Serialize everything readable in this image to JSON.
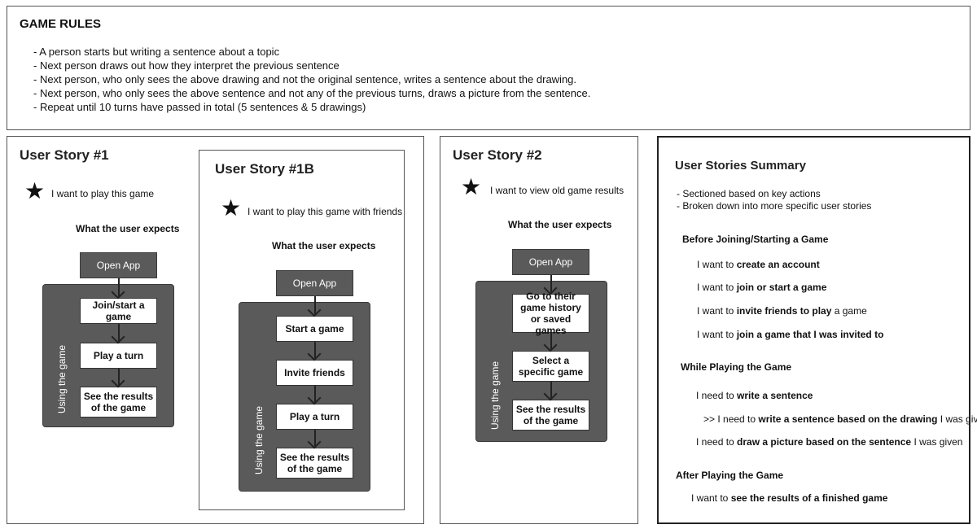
{
  "game_rules": {
    "title": "GAME RULES",
    "lines": [
      "- A person starts but writing a sentence about a topic",
      "- Next person draws out how they interpret the previous sentence",
      "- Next person, who only sees the above drawing and not the original sentence, writes a sentence about the drawing.",
      "- Next person, who only sees the above sentence and not any of the previous turns, draws a picture from the sentence.",
      "- Repeat until 10 turns have passed in total (5 sentences & 5 drawings)"
    ]
  },
  "story1": {
    "title": "User Story #1",
    "want": "I want to play this game",
    "expects": "What the user expects",
    "open_app": "Open App",
    "panel_label": "Using the game",
    "steps": [
      "Join/start a game",
      "Play a turn",
      "See the results of the game"
    ]
  },
  "story1b": {
    "title": "User Story #1B",
    "want": "I want to play this game with friends",
    "expects": "What the user expects",
    "open_app": "Open App",
    "panel_label": "Using the game",
    "steps": [
      "Start a game",
      "Invite friends",
      "Play a turn",
      "See the results of the game"
    ]
  },
  "story2": {
    "title": "User Story #2",
    "want": "I want to view old game results",
    "expects": "What the user expects",
    "open_app": "Open App",
    "panel_label": "Using the game",
    "steps": [
      "Go to their game history or saved games",
      "Select a specific game",
      "See the results of the game"
    ]
  },
  "summary": {
    "title": "User Stories Summary",
    "notes": [
      "- Sectioned based on key actions",
      "- Broken down into more specific user stories"
    ],
    "sections": [
      {
        "heading": "Before Joining/Starting a Game",
        "items": [
          {
            "pre": "I want to ",
            "bold": "create an account",
            "post": ""
          },
          {
            "pre": "I want to ",
            "bold": "join or start a game",
            "post": ""
          },
          {
            "pre": "I want to ",
            "bold": "invite friends to play",
            "post": " a game"
          },
          {
            "pre": "I want to ",
            "bold": "join a game that I was invited to",
            "post": ""
          }
        ]
      },
      {
        "heading": "While Playing the Game",
        "items": [
          {
            "pre": "I need to ",
            "bold": "write a sentence",
            "post": ""
          },
          {
            "pre": ">> I need to ",
            "bold": "write a sentence based on the drawing",
            "post": " I was given"
          },
          {
            "pre": "I need to ",
            "bold": "draw a picture based on the sentence",
            "post": " I was given"
          }
        ]
      },
      {
        "heading": "After Playing the Game",
        "items": [
          {
            "pre": "I want to ",
            "bold": "see the results of a finished game",
            "post": ""
          }
        ]
      }
    ]
  },
  "icons": {
    "star": "star-icon",
    "arrow": "arrow-down-icon"
  }
}
